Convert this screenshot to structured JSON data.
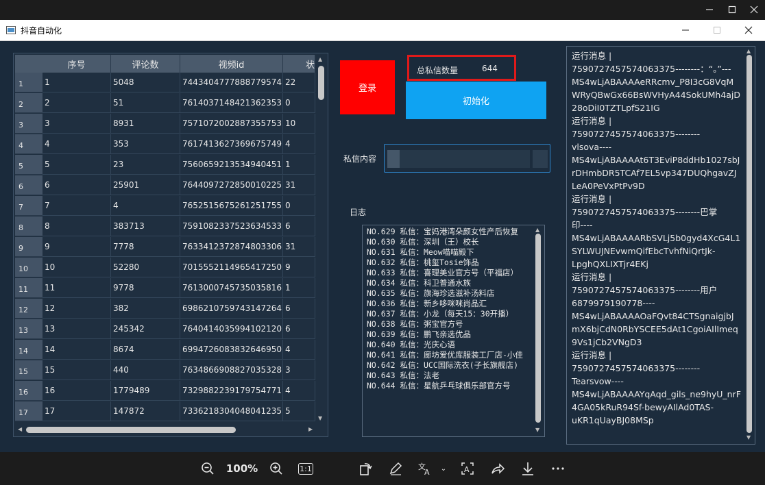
{
  "window": {
    "title": "抖音自动化"
  },
  "table": {
    "headers": [
      "序号",
      "评论数",
      "视频id",
      "状"
    ],
    "rows": [
      {
        "num": "1",
        "id": "1",
        "comments": "5048",
        "video": "7443404777888779574",
        "status": "22"
      },
      {
        "num": "2",
        "id": "2",
        "comments": "51",
        "video": "7614037148421362353",
        "status": "0"
      },
      {
        "num": "3",
        "id": "3",
        "comments": "8931",
        "video": "7571072002887355753",
        "status": "10"
      },
      {
        "num": "4",
        "id": "4",
        "comments": "353",
        "video": "7617413627369675749",
        "status": "4"
      },
      {
        "num": "5",
        "id": "5",
        "comments": "23",
        "video": "7560659213534940451",
        "status": "1"
      },
      {
        "num": "6",
        "id": "6",
        "comments": "25901",
        "video": "7644097272850010225",
        "status": "31"
      },
      {
        "num": "7",
        "id": "7",
        "comments": "4",
        "video": "7652515675261251755",
        "status": "0"
      },
      {
        "num": "8",
        "id": "8",
        "comments": "383713",
        "video": "7591082337523634533",
        "status": "6"
      },
      {
        "num": "9",
        "id": "9",
        "comments": "7778",
        "video": "7633412372874803306",
        "status": "31"
      },
      {
        "num": "10",
        "id": "10",
        "comments": "52280",
        "video": "7015552114965417250",
        "status": "9"
      },
      {
        "num": "11",
        "id": "11",
        "comments": "9778",
        "video": "7613000745735035816",
        "status": "1"
      },
      {
        "num": "12",
        "id": "12",
        "comments": "382",
        "video": "6986210759743147264",
        "status": "6"
      },
      {
        "num": "13",
        "id": "13",
        "comments": "245342",
        "video": "7640414035994102120",
        "status": "6"
      },
      {
        "num": "14",
        "id": "14",
        "comments": "8674",
        "video": "6994726083832646950",
        "status": "4"
      },
      {
        "num": "15",
        "id": "15",
        "comments": "440",
        "video": "7634866908827035328",
        "status": "3"
      },
      {
        "num": "16",
        "id": "16",
        "comments": "1779489",
        "video": "7329882239179754771",
        "status": "4"
      },
      {
        "num": "17",
        "id": "17",
        "comments": "147872",
        "video": "7336218304048041235",
        "status": "5"
      }
    ]
  },
  "controls": {
    "login_label": "登录",
    "count_label": "总私信数量",
    "count_value": "644",
    "init_label": "初始化",
    "message_label": "私信内容",
    "log_label": "日志"
  },
  "log": [
    "NO.629 私信：宝妈港湾朵颜女性产后恢复",
    "NO.630 私信：深圳（王）校长",
    "NO.631 私信：Meow喵喵殿下",
    "NO.632 私信：桃玺Tosie饰品",
    "NO.633 私信：喜理美业官方号（平福店）",
    "NO.634 私信：科卫普通水族",
    "NO.635 私信：旗海珍选滋补汤料店",
    "NO.636 私信：新乡哆咪咪尚品汇",
    "NO.637 私信：小龙（每天15：30开播）",
    "NO.638 私信：粥宝官方号",
    "NO.639 私信：鹏飞亲选优品",
    "NO.640 私信：光庆心语",
    "NO.641 私信：廊坊爱优库服装工厂店-小佳",
    "NO.642 私信：UCC国际洗衣(子长旗舰店)",
    "NO.643 私信：法老",
    "NO.644 私信：星航乒乓球俱乐部官方号"
  ],
  "runtime": [
    "运行消息 |",
    "7590727457574063375--------：“。”---",
    "MS4wLjABAAAAeRRcmv_P8I3cG8VqM",
    "WRyQBwGx66BsWVHyA44SokUMh4ajD",
    "28oDiI0TZTLpfS21IG",
    "运行消息 |",
    "7590727457574063375--------",
    "vlsova----",
    "MS4wLjABAAAAt6T3EviP8ddHb1027sbJ",
    "rDHmbDR5TCAf7EL5vp347DUQhgavZJ",
    "LeA0PeVxPtPv9D",
    "运行消息 |",
    "7590727457574063375--------巴掌",
    "印----",
    "MS4wLjABAAAARbSVLj5b0gyd4XcG4L1",
    "SYLWUJNEvwmQifEbcTvhfNiQrtJk-",
    "LpghQXLIXTjr4EKj",
    "运行消息 |",
    "7590727457574063375--------用户",
    "6879979190778----",
    "MS4wLjABAAAAOaFQvt84CTSgnaigjbJ",
    "mX6bjCdN0RbYSCEE5dAt1CgoiAIlImeq",
    "9Vs1jCb2VNgD3",
    "运行消息 |",
    "7590727457574063375--------",
    "Tearsvow----",
    "MS4wLjABAAAAYqAqd_gils_ne9hyU_nrF",
    "4GA05kRuR94Sf-bewyAIlAd0TAS-",
    "uKR1qUayBJ08MSp"
  ],
  "viewer": {
    "zoom": "100%",
    "ratio": "1:1"
  },
  "icons": {
    "minimize": "minimize-icon",
    "maximize": "maximize-icon",
    "close": "close-icon"
  }
}
